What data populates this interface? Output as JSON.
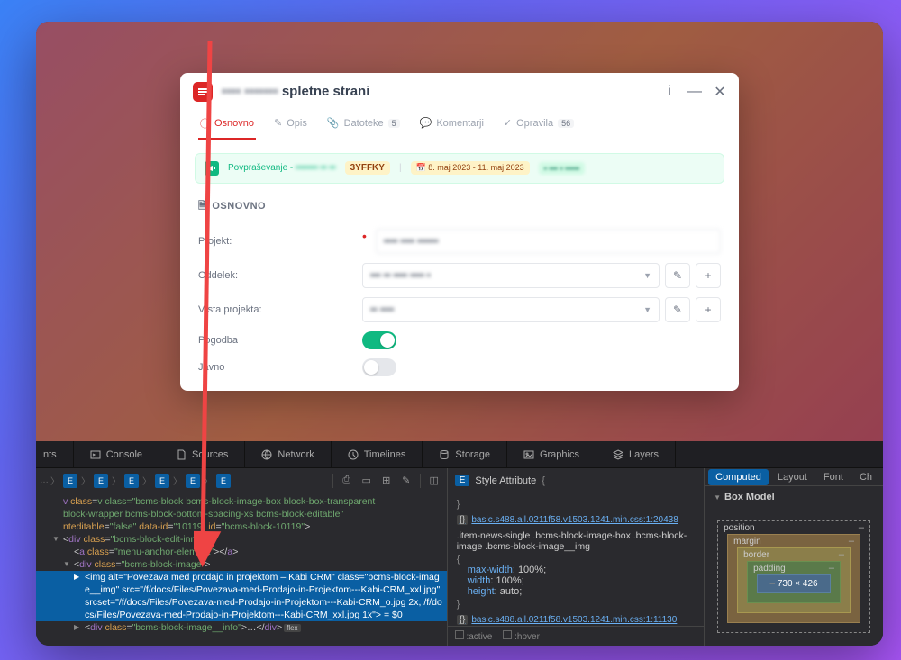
{
  "dialog": {
    "title_prefix": "▪▪▪▪ ▪▪▪▪▪▪▪",
    "title_suffix": "spletne strani",
    "tabs": [
      {
        "icon": "info",
        "label": "Osnovno",
        "active": true
      },
      {
        "icon": "pen",
        "label": "Opis"
      },
      {
        "icon": "clip",
        "label": "Datoteke",
        "badge": "5"
      },
      {
        "icon": "chat",
        "label": "Komentarji"
      },
      {
        "icon": "check",
        "label": "Opravila",
        "badge": "56"
      }
    ],
    "info_bar": {
      "link_text": "Povpraševanje",
      "link_blur": "▪▪▪▪▪▪▪ ▪▪ ▪▪",
      "badge1": "3YFFKY",
      "badge2": "8. maj 2023 - 11. maj 2023",
      "badge3": "▪ ▪▪▪ ▪ ▪▪▪▪▪"
    },
    "section_title": "OSNOVNO",
    "rows": {
      "projekt": {
        "label": "Projekt:",
        "value": "▪▪▪▪   ▪▪▪▪ ▪▪▪▪▪▪",
        "required": true
      },
      "oddelek": {
        "label": "Oddelek:",
        "value": "▪▪▪ ▪▪  ▪▪▪▪ ▪▪▪▪ ▪"
      },
      "vrsta": {
        "label": "Vrsta projekta:",
        "value": "▪▪ ▪▪▪▪"
      },
      "pogodba": {
        "label": "Pogodba",
        "on": true
      },
      "javno": {
        "label": "Javno",
        "on": false
      }
    }
  },
  "devtools": {
    "tabs": [
      "nts",
      "Console",
      "Sources",
      "Network",
      "Timelines",
      "Storage",
      "Graphics",
      "Layers"
    ],
    "dom": {
      "l1": "v class=\"bcms-block bcms-block-image-box block-box-transparent",
      "l2": "block-wrapper bcms-block-bottom-spacing-xs bcms-block-editable\"",
      "l3": "nteditable=\"false\" data-id=\"10119\" id=\"bcms-block-10119\">",
      "l4": "<div class=\"bcms-block-edit-inner\">",
      "l5": "<a class=\"menu-anchor-element\"></a>",
      "l6": "<div class=\"bcms-block-image\">",
      "sel": "<img alt=\"Povezava med prodajo in projektom – Kabi CRM\" class=\"bcms-block-image__img\" src=\"/f/docs/Files/Povezava-med-Prodajo-in-Projektom---Kabi-CRM_xxl.jpg\" srcset=\"/f/docs/Files/Povezava-med-Prodajo-in-Projektom---Kabi-CRM_o.jpg 2x, /f/docs/Files/Povezava-med-Prodajo-in-Projektom---Kabi-CRM_xxl.jpg 1x\"> = $0",
      "l8": "<div class=\"bcms-block-image__info\">…</div>"
    },
    "styles": {
      "header": "Style Attribute",
      "src1": "basic.s488.all.0211f58.v1503.1241.min.css:1:20438",
      "sel1": ".item-news-single .bcms-block-image-box .bcms-block-image .bcms-block-image__img",
      "p1k": "max-width",
      "p1v": "100%",
      "p2k": "width",
      "p2v": "100%",
      "p3k": "height",
      "p3v": "auto",
      "src2": "basic.s488.all.0211f58.v1503.1241.min.css:1:11130",
      "fa": ":active",
      "fh": ":hover"
    },
    "right": {
      "tabs": [
        "Computed",
        "Layout",
        "Font",
        "Ch"
      ],
      "section": "Box Model",
      "pos": "position",
      "margin": "margin",
      "border": "border",
      "padding": "padding",
      "content": "730 × 426"
    }
  }
}
